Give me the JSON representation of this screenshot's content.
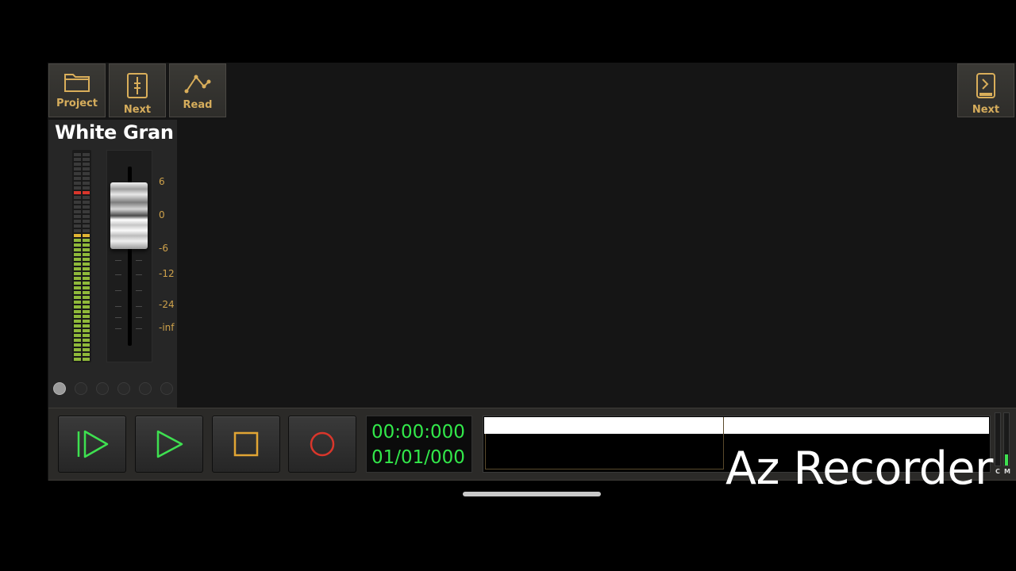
{
  "toolbar": {
    "project_label": "Project",
    "next_label": "Next",
    "read_label": "Read",
    "right_next_label": "Next"
  },
  "track": {
    "name": "White Gran",
    "scale": [
      "6",
      "0",
      "-6",
      "-12",
      "-24",
      "-inf"
    ]
  },
  "transport": {
    "time": "00:00:000",
    "position": "01/01/000"
  },
  "master_meter": {
    "left_label": "C",
    "right_label": "M"
  },
  "watermark": "Az Recorder",
  "colors": {
    "accent": "#d6ad5c",
    "counter": "#32e84a",
    "record": "#d9362b",
    "play": "#3ee050",
    "stop": "#e1a534"
  }
}
